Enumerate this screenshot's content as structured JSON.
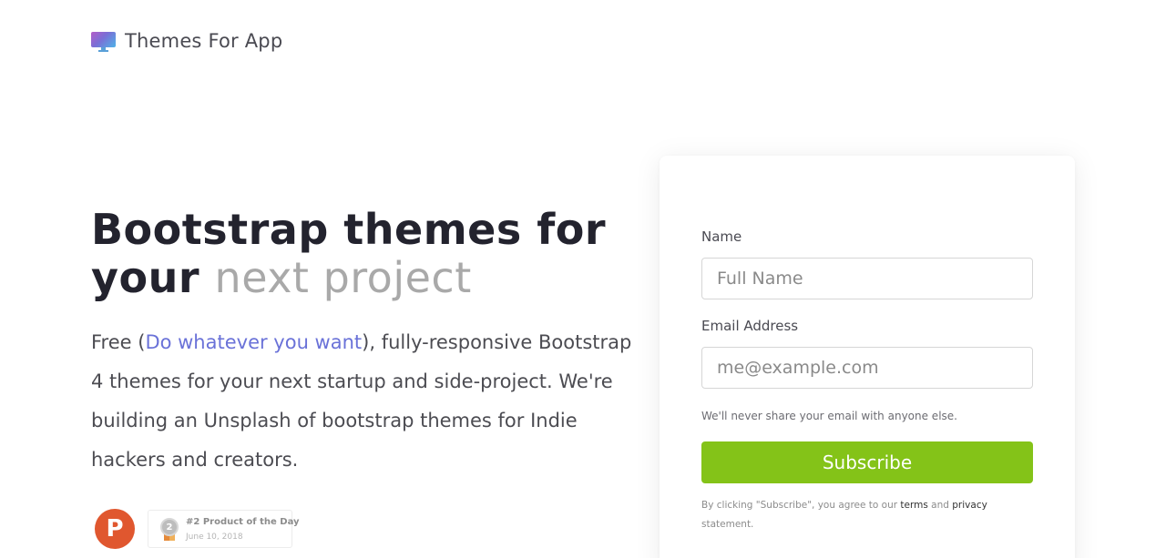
{
  "brand": {
    "name": "Themes For App",
    "icon": "monitor-logo-icon"
  },
  "hero": {
    "title_dark_1": "Bootstrap themes for",
    "title_dark_2": "your",
    "title_light": "next project",
    "desc_prefix": "Free (",
    "desc_link": "Do whatever you want",
    "desc_suffix": "), fully-responsive Bootstrap 4 themes for your next startup and side-project. We're building an Unsplash of bootstrap themes for Indie hackers and creators."
  },
  "product_hunt": {
    "logo_letter": "P",
    "medal_number": "2",
    "badge_title": "#2 Product of the Day",
    "badge_date": "June 10, 2018"
  },
  "form": {
    "name_label": "Name",
    "name_placeholder": "Full Name",
    "name_value": "",
    "email_label": "Email Address",
    "email_placeholder": "me@example.com",
    "email_value": "",
    "help_text": "We'll never share your email with anyone else.",
    "submit_label": "Subscribe",
    "legal_prefix": "By clicking \"Subscribe\", you agree to our ",
    "legal_terms": "terms",
    "legal_and": " and ",
    "legal_privacy": "privacy",
    "legal_suffix": " statement."
  },
  "colors": {
    "accent_link": "#6a72d8",
    "button_green": "#84c318",
    "product_hunt_orange": "#e0572f",
    "title_dark": "#23232e",
    "title_light": "#a9a9a9"
  }
}
